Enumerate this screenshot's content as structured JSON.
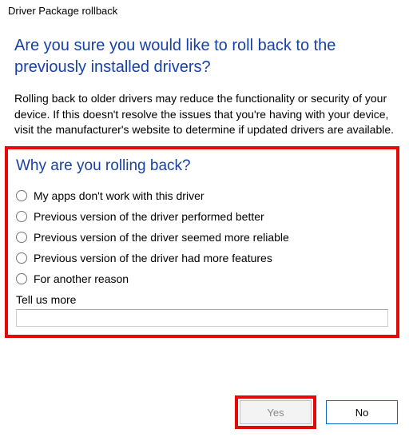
{
  "window": {
    "title": "Driver Package rollback"
  },
  "dialog": {
    "heading": "Are you sure you would like to roll back to the previously installed drivers?",
    "body": "Rolling back to older drivers may reduce the functionality or security of your device. If this doesn't resolve the issues that you're having with your device, visit the manufacturer's website to determine if updated drivers are available.",
    "survey_heading": "Why are you rolling back?",
    "options": [
      "My apps don't work with this driver",
      "Previous version of the driver performed better",
      "Previous version of the driver seemed more reliable",
      "Previous version of the driver had more features",
      "For another reason"
    ],
    "tell_us_label": "Tell us more",
    "tell_us_value": ""
  },
  "buttons": {
    "yes": "Yes",
    "no": "No"
  },
  "highlights": {
    "survey_section": true,
    "yes_button": true
  }
}
